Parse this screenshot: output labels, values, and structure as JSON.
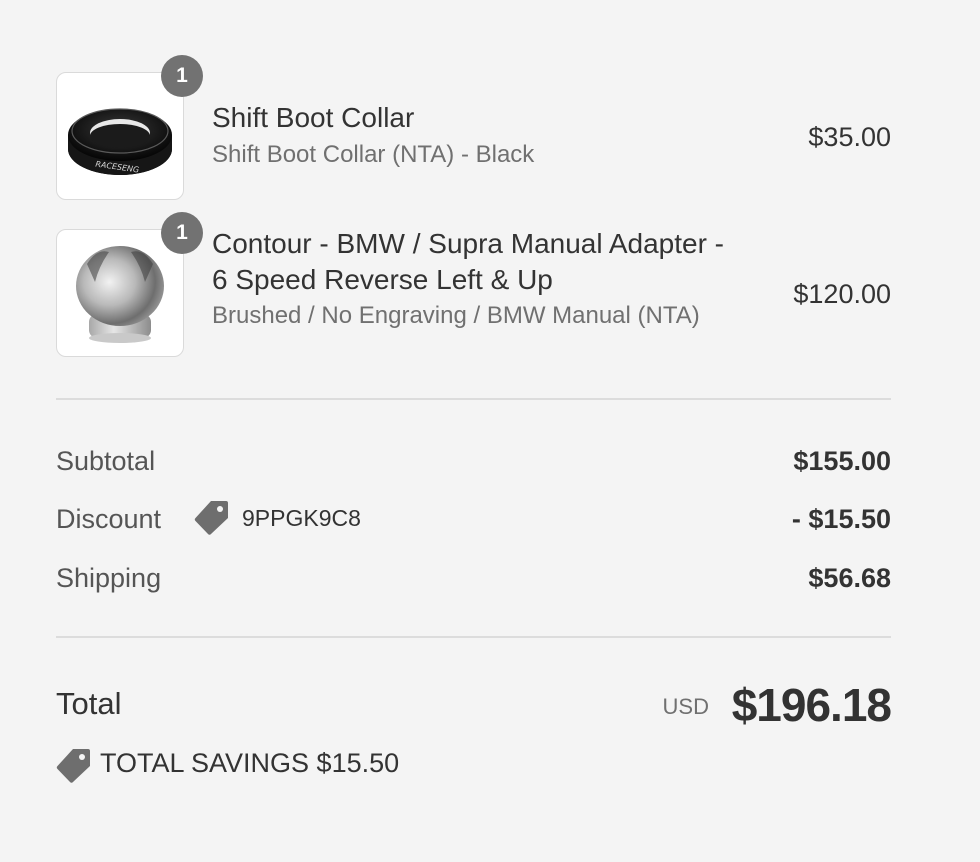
{
  "line_items": [
    {
      "quantity": "1",
      "title": "Shift Boot Collar",
      "variant": "Shift Boot Collar (NTA) - Black",
      "price": "$35.00",
      "image_icon": "black-collar-ring-image",
      "image_text": "RACESENG"
    },
    {
      "quantity": "1",
      "title": "Contour - BMW / Supra Manual Adapter - 6 Speed Reverse Left & Up",
      "variant": "Brushed / No Engraving / BMW Manual (NTA)",
      "price": "$120.00",
      "image_icon": "brushed-shift-knob-image"
    }
  ],
  "totals": {
    "subtotal_label": "Subtotal",
    "subtotal_value": "$155.00",
    "discount_label": "Discount",
    "discount_code": "9PPGK9C8",
    "discount_icon": "tag-icon",
    "discount_value": "- $15.50",
    "shipping_label": "Shipping",
    "shipping_value": "$56.68"
  },
  "total": {
    "label": "Total",
    "currency": "USD",
    "value": "$196.18",
    "savings_icon": "tag-icon",
    "savings_text": "TOTAL SAVINGS $15.50"
  },
  "colors": {
    "background": "#f4f4f4",
    "badge": "#727272",
    "text": "#333333",
    "muted_text": "#707070",
    "divider": "#dcdcdc"
  }
}
